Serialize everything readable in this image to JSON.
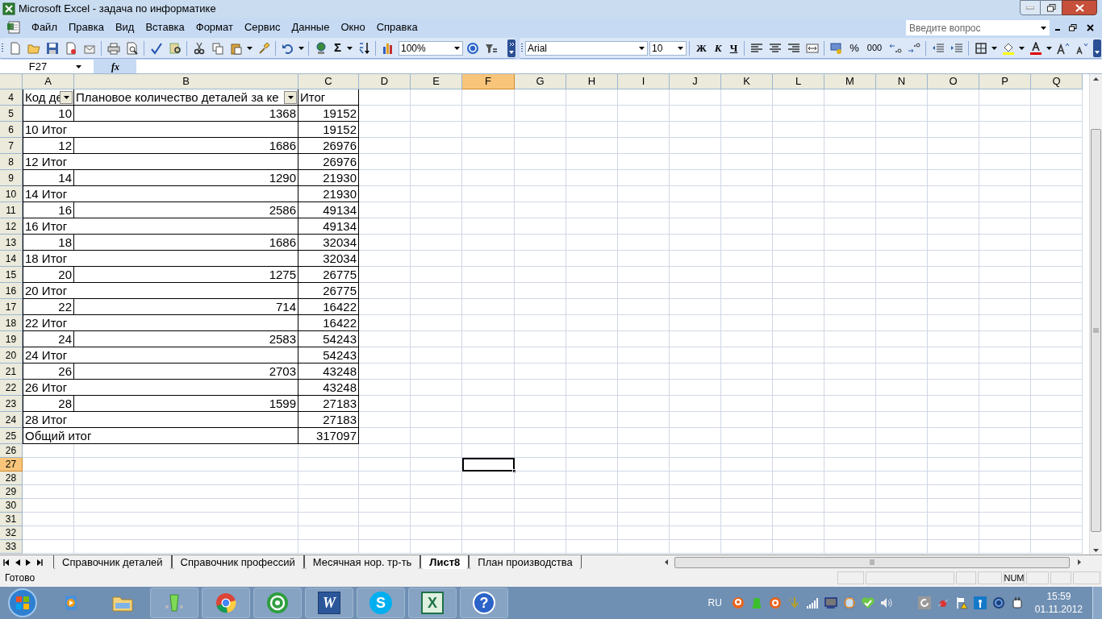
{
  "window": {
    "title": "Microsoft Excel - задача по информатике"
  },
  "menu": [
    {
      "label": "Файл"
    },
    {
      "label": "Правка"
    },
    {
      "label": "Вид"
    },
    {
      "label": "Вставка"
    },
    {
      "label": "Формат"
    },
    {
      "label": "Сервис"
    },
    {
      "label": "Данные"
    },
    {
      "label": "Окно"
    },
    {
      "label": "Справка"
    }
  ],
  "help_search": {
    "placeholder": "Введите вопрос"
  },
  "standard_toolbar": {
    "sum_symbol": "Σ",
    "zoom": "100%"
  },
  "formatting_toolbar": {
    "font": "Arial",
    "size": "10",
    "bold": "Ж",
    "italic": "К",
    "underline": "Ч",
    "percent": "%",
    "thousands": "000"
  },
  "formula_bar": {
    "name_box": "F27",
    "fx": "fx"
  },
  "columns": [
    {
      "label": "A",
      "selected": false
    },
    {
      "label": "B",
      "selected": false
    },
    {
      "label": "C",
      "selected": false
    },
    {
      "label": "D",
      "selected": false
    },
    {
      "label": "E",
      "selected": false
    },
    {
      "label": "F",
      "selected": true
    },
    {
      "label": "G",
      "selected": false
    },
    {
      "label": "H",
      "selected": false
    },
    {
      "label": "I",
      "selected": false
    },
    {
      "label": "J",
      "selected": false
    },
    {
      "label": "K",
      "selected": false
    },
    {
      "label": "L",
      "selected": false
    },
    {
      "label": "M",
      "selected": false
    },
    {
      "label": "N",
      "selected": false
    },
    {
      "label": "O",
      "selected": false
    },
    {
      "label": "P",
      "selected": false
    },
    {
      "label": "Q",
      "selected": false
    }
  ],
  "rows": [
    {
      "number": "4",
      "kind": "header",
      "selected": false,
      "cells": [
        {
          "text": "Код де",
          "filter": true
        },
        {
          "text": "Плановое количество деталей за ке",
          "filter": true
        },
        {
          "text": "Итог",
          "filter": false
        }
      ]
    },
    {
      "number": "5",
      "kind": "detail",
      "selected": false,
      "code": "10",
      "quantity": "1368",
      "total": "19152"
    },
    {
      "number": "6",
      "kind": "subtotal",
      "selected": false,
      "label": "10 Итог",
      "total": "19152"
    },
    {
      "number": "7",
      "kind": "detail",
      "selected": false,
      "code": "12",
      "quantity": "1686",
      "total": "26976"
    },
    {
      "number": "8",
      "kind": "subtotal",
      "selected": false,
      "label": "12 Итог",
      "total": "26976"
    },
    {
      "number": "9",
      "kind": "detail",
      "selected": false,
      "code": "14",
      "quantity": "1290",
      "total": "21930"
    },
    {
      "number": "10",
      "kind": "subtotal",
      "selected": false,
      "label": "14 Итог",
      "total": "21930"
    },
    {
      "number": "11",
      "kind": "detail",
      "selected": false,
      "code": "16",
      "quantity": "2586",
      "total": "49134"
    },
    {
      "number": "12",
      "kind": "subtotal",
      "selected": false,
      "label": "16 Итог",
      "total": "49134"
    },
    {
      "number": "13",
      "kind": "detail",
      "selected": false,
      "code": "18",
      "quantity": "1686",
      "total": "32034"
    },
    {
      "number": "14",
      "kind": "subtotal",
      "selected": false,
      "label": "18 Итог",
      "total": "32034"
    },
    {
      "number": "15",
      "kind": "detail",
      "selected": false,
      "code": "20",
      "quantity": "1275",
      "total": "26775"
    },
    {
      "number": "16",
      "kind": "subtotal",
      "selected": false,
      "label": "20 Итог",
      "total": "26775"
    },
    {
      "number": "17",
      "kind": "detail",
      "selected": false,
      "code": "22",
      "quantity": "714",
      "total": "16422"
    },
    {
      "number": "18",
      "kind": "subtotal",
      "selected": false,
      "label": "22 Итог",
      "total": "16422"
    },
    {
      "number": "19",
      "kind": "detail",
      "selected": false,
      "code": "24",
      "quantity": "2583",
      "total": "54243"
    },
    {
      "number": "20",
      "kind": "subtotal",
      "selected": false,
      "label": "24 Итог",
      "total": "54243"
    },
    {
      "number": "21",
      "kind": "detail",
      "selected": false,
      "code": "26",
      "quantity": "2703",
      "total": "43248"
    },
    {
      "number": "22",
      "kind": "subtotal",
      "selected": false,
      "label": "26 Итог",
      "total": "43248"
    },
    {
      "number": "23",
      "kind": "detail",
      "selected": false,
      "code": "28",
      "quantity": "1599",
      "total": "27183"
    },
    {
      "number": "24",
      "kind": "subtotal",
      "selected": false,
      "label": "28 Итог",
      "total": "27183"
    },
    {
      "number": "25",
      "kind": "grand",
      "selected": false,
      "label": "Общий итог",
      "total": "317097"
    },
    {
      "number": "26",
      "kind": "empty",
      "selected": false
    },
    {
      "number": "27",
      "kind": "empty",
      "selected": true
    },
    {
      "number": "28",
      "kind": "empty",
      "selected": false
    },
    {
      "number": "29",
      "kind": "empty",
      "selected": false
    },
    {
      "number": "30",
      "kind": "empty",
      "selected": false
    },
    {
      "number": "31",
      "kind": "empty",
      "selected": false
    },
    {
      "number": "32",
      "kind": "empty",
      "selected": false
    },
    {
      "number": "33",
      "kind": "empty",
      "selected": false
    }
  ],
  "sheet_tabs": [
    {
      "label": "Справочник деталей",
      "selected": false
    },
    {
      "label": "Справочник профессий",
      "selected": false
    },
    {
      "label": "Месячная нор. тр-ть",
      "selected": false
    },
    {
      "label": "Лист8",
      "selected": true
    },
    {
      "label": "План производства",
      "selected": false
    }
  ],
  "status_bar": {
    "text": "Готово",
    "num": "NUM"
  },
  "taskbar": {
    "items": [
      {
        "kind": "media"
      },
      {
        "kind": "folder"
      },
      {
        "kind": "glass"
      },
      {
        "kind": "browser"
      },
      {
        "kind": "mail"
      },
      {
        "kind": "word",
        "glyph": "W"
      },
      {
        "kind": "skype",
        "glyph": "S"
      },
      {
        "kind": "excel",
        "glyph": "X"
      },
      {
        "kind": "help",
        "glyph": "?"
      }
    ],
    "language": "RU",
    "time": "15:59",
    "date": "01.11.2012"
  }
}
